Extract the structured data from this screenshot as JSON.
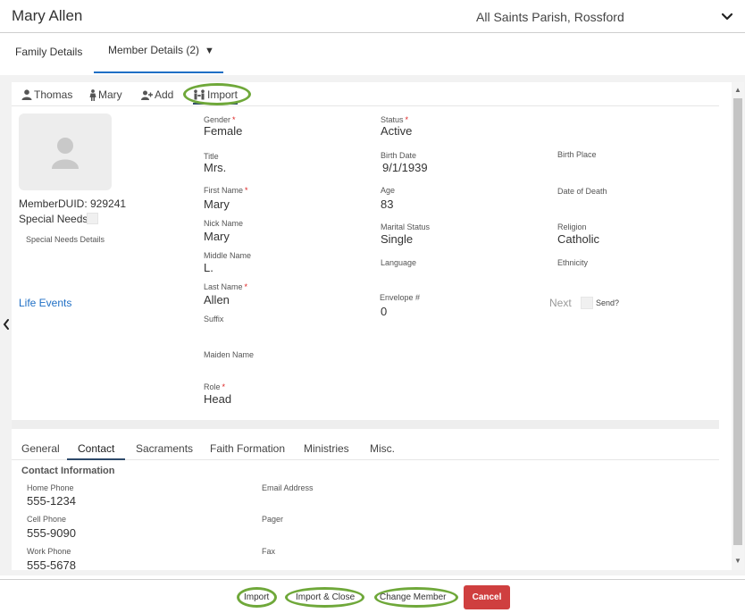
{
  "header": {
    "title": "Mary Allen",
    "parish": "All Saints Parish, Rossford",
    "chevron_icon": "chevron-down-icon"
  },
  "top_tabs": {
    "family": "Family Details",
    "member": "Member Details (2)",
    "member_caret": "▼"
  },
  "person_tabs": [
    {
      "label": "Thomas",
      "icon": "user-icon"
    },
    {
      "label": "Mary",
      "icon": "female-icon"
    },
    {
      "label": "Add",
      "icon": "add-user-icon"
    },
    {
      "label": "Import",
      "icon": "import-family-icon"
    }
  ],
  "profile": {
    "duid_label": "MemberDUID: 929241",
    "special_needs_label": "Special Needs",
    "special_needs_details_label": "Special Needs Details",
    "life_events_link": "Life Events"
  },
  "fields": {
    "gender": {
      "label": "Gender",
      "value": "Female",
      "required": "*"
    },
    "title": {
      "label": "Title",
      "value": "Mrs."
    },
    "first_name": {
      "label": "First Name",
      "value": "Mary",
      "required": "*"
    },
    "nick_name": {
      "label": "Nick Name",
      "value": "Mary"
    },
    "middle_name": {
      "label": "Middle Name",
      "value": "L."
    },
    "last_name": {
      "label": "Last Name",
      "value": "Allen",
      "required": "*"
    },
    "suffix": {
      "label": "Suffix",
      "value": ""
    },
    "maiden_name": {
      "label": "Maiden Name",
      "value": ""
    },
    "role": {
      "label": "Role",
      "value": "Head",
      "required": "*"
    },
    "status": {
      "label": "Status",
      "value": "Active",
      "required": "*"
    },
    "birth_date": {
      "label": "Birth Date",
      "value": "9/1/1939"
    },
    "age": {
      "label": "Age",
      "value": "83"
    },
    "marital_status": {
      "label": "Marital Status",
      "value": "Single"
    },
    "language": {
      "label": "Language",
      "value": ""
    },
    "envelope": {
      "label": "Envelope #",
      "value": "0"
    },
    "birth_place": {
      "label": "Birth Place",
      "value": ""
    },
    "date_of_death": {
      "label": "Date of Death",
      "value": ""
    },
    "religion": {
      "label": "Religion",
      "value": "Catholic"
    },
    "ethnicity": {
      "label": "Ethnicity",
      "value": ""
    }
  },
  "envelope_extra": {
    "next_label": "Next",
    "send_label": "Send?"
  },
  "sub_tabs": [
    "General",
    "Contact",
    "Sacraments",
    "Faith Formation",
    "Ministries",
    "Misc."
  ],
  "contact": {
    "section_title": "Contact Information",
    "home_phone": {
      "label": "Home Phone",
      "value": "555-1234"
    },
    "cell_phone": {
      "label": "Cell Phone",
      "value": "555-9090"
    },
    "work_phone": {
      "label": "Work Phone",
      "value": "555-5678"
    },
    "email": {
      "label": "Email Address",
      "value": ""
    },
    "pager": {
      "label": "Pager",
      "value": ""
    },
    "fax": {
      "label": "Fax",
      "value": ""
    }
  },
  "buttons": {
    "import": "Import",
    "import_close": "Import & Close",
    "change_member": "Change Member",
    "cancel": "Cancel"
  },
  "colors": {
    "accent_blue": "#1f6fc5",
    "highlight_green": "#6fa83a",
    "cancel_red": "#cf3f3f",
    "required_red": "#dd2222"
  }
}
